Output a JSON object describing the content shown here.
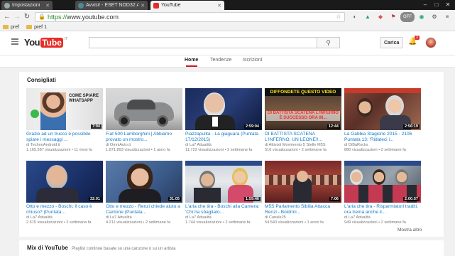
{
  "browser": {
    "tabs": [
      {
        "label": "Impostazioni",
        "icon": "gear-icon"
      },
      {
        "label": "Avvisi! - ESET NOD32 Ant",
        "icon": "headset-icon"
      },
      {
        "label": "YouTube",
        "icon": "youtube-icon",
        "active": true
      }
    ],
    "url_scheme": "https://",
    "url_host": "www.youtube.com",
    "bookmarks": [
      "pref",
      "pref 1"
    ],
    "ext_badge": "OFF"
  },
  "youtube": {
    "logo_you": "You",
    "logo_tube": "Tube",
    "logo_country": "IT",
    "upload_label": "Carica",
    "notifications": "3",
    "nav": [
      "Home",
      "Tendenze",
      "Iscrizioni"
    ],
    "section_title": "Consigliati",
    "more_label": "Mostra altro",
    "mix_title": "Mix di YouTube",
    "mix_sub": "Playlist continue basate su una canzone o su un artista"
  },
  "videos": [
    {
      "title": "Grazie ad un trucco è possibile spiare i messaggi ...",
      "channel": "di TechnoAndroid.it",
      "views": "1.165.587 visualizzazioni",
      "age": "11 mesi fa",
      "duration": "7:04"
    },
    {
      "title": "Fiat 500 Lamborghini | Abbiamo provato un mostro...",
      "channel": "di OmniAuto.it",
      "views": "1.871.893 visualizzazioni",
      "age": "1 anno fa",
      "duration": ""
    },
    {
      "title": "Piazzapulita - La giaguara (Puntata 17/12/2015)",
      "channel": "di La7 Attualità",
      "views": "11.722 visualizzazioni",
      "age": "2 settimane fa",
      "duration": "2:59:04"
    },
    {
      "title": "DI BATTISTA SCATENA L'INFERNO, UN LEONE!!...",
      "channel": "di Attivisti Movimento 5 Stelle M5S",
      "views": "510 visualizzazioni",
      "age": "2 settimane fa",
      "duration": "12:44"
    },
    {
      "title": "La Gabbia Stagione 2015 - 2106 Puntata 13: 'Ridateci i...",
      "channel": "di DiBaRocks",
      "views": "880 visualizzazioni",
      "age": "2 settimane fa",
      "duration": "2:56:19"
    },
    {
      "title": "Otto e mezzo - Boschi, il caso è chiuso? (Puntata...",
      "channel": "di La7 Attualità",
      "views": "2.615 visualizzazioni",
      "age": "2 settimane fa",
      "duration": "32:01"
    },
    {
      "title": "Otto e mezzo - Renzi chiede aiuto a Cantone (Puntata...",
      "channel": "di La7 Attualità",
      "views": "4.211 visualizzazioni",
      "age": "2 settimane fa",
      "duration": "31:05"
    },
    {
      "title": "L'aria che tira - Boschi alla Camera: 'Chi ha sbagliato...",
      "channel": "di La7 Attualità",
      "views": "1.744 visualizzazioni",
      "age": "2 settimane fa",
      "duration": "1:59:46"
    },
    {
      "title": "M5S Parlamento Sibilia Attacca Renzi - Boldrini...",
      "channel": "di Canale25 ",
      "views": "54.540 visualizzazioni",
      "age": "1 anno fa",
      "duration": "7:06"
    },
    {
      "title": "L'aria che tira - Risparmiatori traditi, ora trema anche il...",
      "channel": "di La7 Attualità",
      "views": "949 visualizzazioni",
      "age": "2 settimane fa",
      "duration": "2:00:57"
    }
  ],
  "thumb_overlays": {
    "v0": "COME SPIARE WHATSAPP",
    "v3_top": "DIFFONDETE QUESTO VIDEO",
    "v3_bottom": "DI BATTISTA SCATENA L'INFERNO È SUCCESSO ORA IN..."
  }
}
